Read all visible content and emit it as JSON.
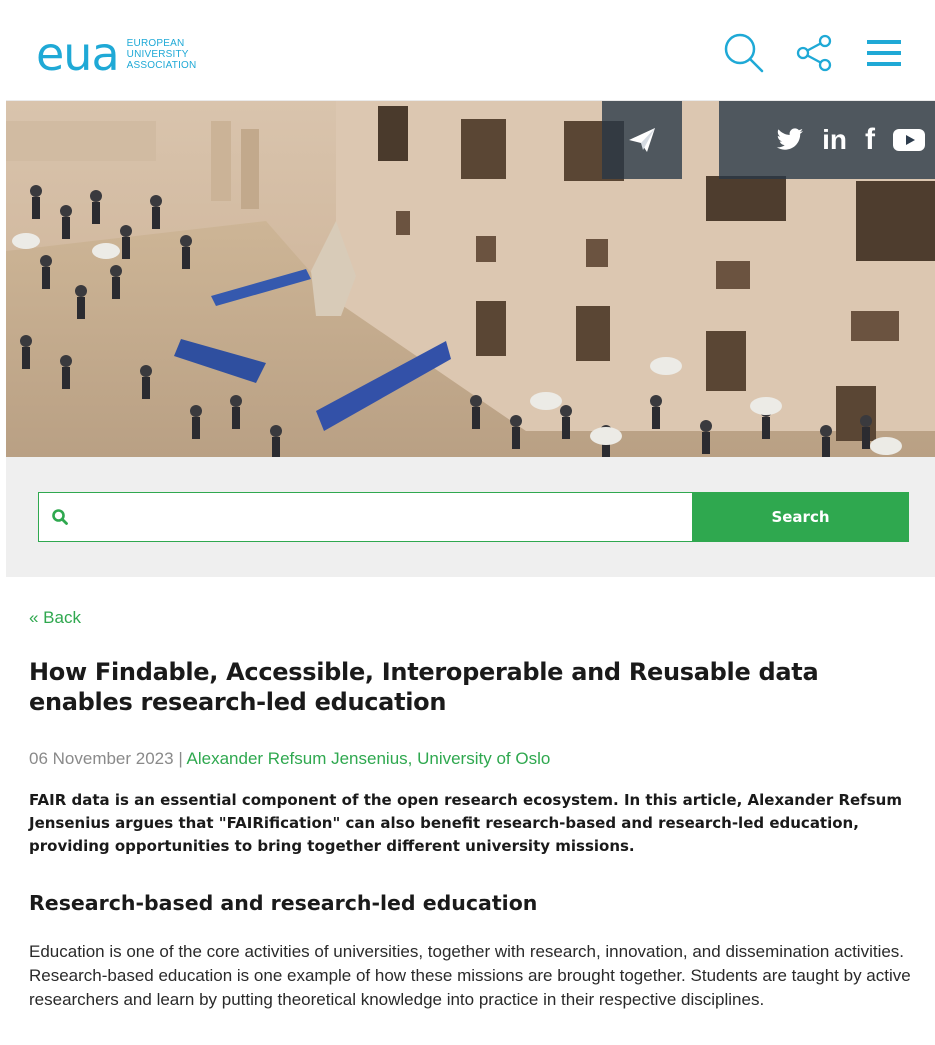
{
  "logo": {
    "mark": "eua",
    "line1": "EUROPEAN",
    "line2": "UNIVERSITY",
    "line3": "ASSOCIATION"
  },
  "header_icons": [
    "search-icon",
    "share-icon",
    "menu-icon"
  ],
  "social": [
    "send-icon",
    "twitter-icon",
    "linkedin-icon",
    "facebook-icon",
    "youtube-icon"
  ],
  "social_text": {
    "linkedin": "in",
    "facebook": "f"
  },
  "search": {
    "placeholder": "",
    "button_label": "Search"
  },
  "article": {
    "back_label": "« Back",
    "title": "How Findable, Accessible, Interoperable and Reusable data enables research-led education",
    "date": "06 November 2023",
    "separator": " | ",
    "author": "Alexander Refsum Jensenius, University of Oslo",
    "lead": "FAIR data is an essential component of the open research ecosystem. In this article, Alexander Refsum Jensenius argues that \"FAIRification\" can also benefit research-based and research-led education, providing opportunities to bring together different university missions.",
    "section_heading": "Research-based and research-led education",
    "paragraph": "Education is one of the core activities of universities, together with research, innovation, and dissemination activities. Research-based education is one example of how these missions are brought together. Students are taught by active researchers and learn by putting theoretical knowledge into practice in their respective disciplines."
  },
  "colors": {
    "brand_blue": "#1fa9d6",
    "accent_green": "#2fa84f",
    "hero_overlay": "#28374a"
  }
}
